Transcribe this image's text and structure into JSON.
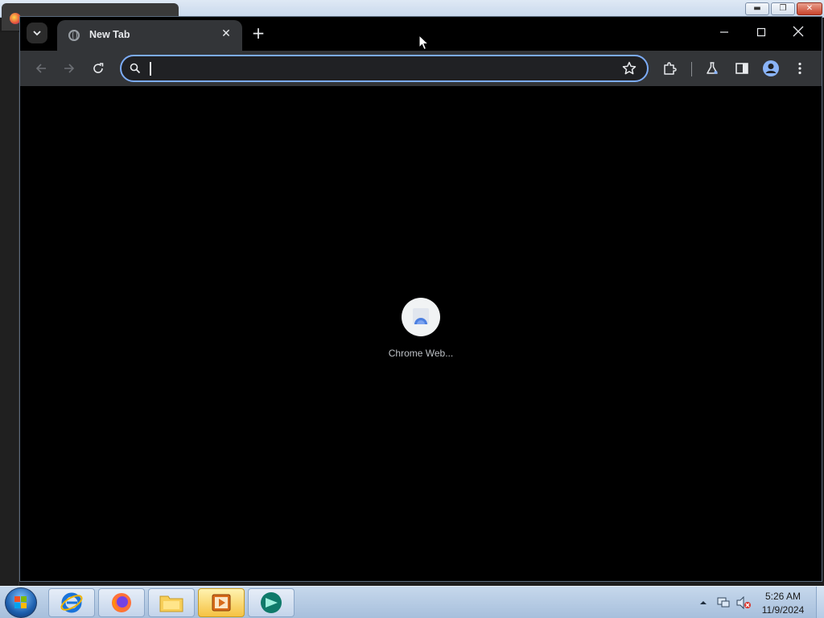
{
  "browser": {
    "tab_title": "New Tab",
    "omnibox_value": "",
    "shortcuts": [
      {
        "label": "Chrome Web..."
      }
    ]
  },
  "taskbar": {
    "clock_time": "5:26 AM",
    "clock_date": "11/9/2024",
    "apps": [
      {
        "name": "Internet Explorer",
        "icon": "ie-icon"
      },
      {
        "name": "Firefox",
        "icon": "firefox-icon"
      },
      {
        "name": "File Explorer",
        "icon": "folder-icon"
      },
      {
        "name": "Media Player",
        "icon": "media-player-icon",
        "active": true
      },
      {
        "name": "App",
        "icon": "green-app-icon"
      }
    ]
  },
  "colors": {
    "omnibox_focus": "#7cacf8",
    "toolbar_bg": "#333538",
    "content_bg": "#000000"
  }
}
